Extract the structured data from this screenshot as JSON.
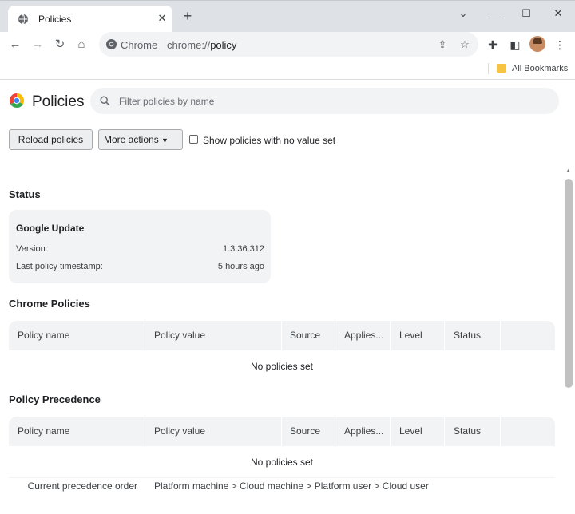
{
  "browser": {
    "tab_title": "Policies",
    "url_scheme_label": "Chrome",
    "url": "chrome://policy",
    "url_prefix": "chrome://",
    "url_host": "policy",
    "bookmarks_label": "All Bookmarks"
  },
  "page": {
    "title": "Policies",
    "filter_placeholder": "Filter policies by name",
    "reload_label": "Reload policies",
    "more_actions_label": "More actions",
    "show_unset_label": "Show policies with no value set",
    "show_unset_checked": false
  },
  "status": {
    "heading": "Status",
    "card_title": "Google Update",
    "version_label": "Version:",
    "version_value": "1.3.36.312",
    "timestamp_label": "Last policy timestamp:",
    "timestamp_value": "5 hours ago"
  },
  "chrome_policies": {
    "heading": "Chrome Policies",
    "columns": [
      "Policy name",
      "Policy value",
      "Source",
      "Applies...",
      "Level",
      "Status"
    ],
    "empty_text": "No policies set"
  },
  "policy_precedence": {
    "heading": "Policy Precedence",
    "columns": [
      "Policy name",
      "Policy value",
      "Source",
      "Applies...",
      "Level",
      "Status"
    ],
    "empty_text": "No policies set",
    "precedence_label": "Current precedence order",
    "precedence_value": "Platform machine > Cloud machine > Platform user > Cloud user"
  },
  "colors": {
    "tabstrip": "#dee1e6",
    "surface": "#f1f3f4",
    "text": "#202124"
  }
}
